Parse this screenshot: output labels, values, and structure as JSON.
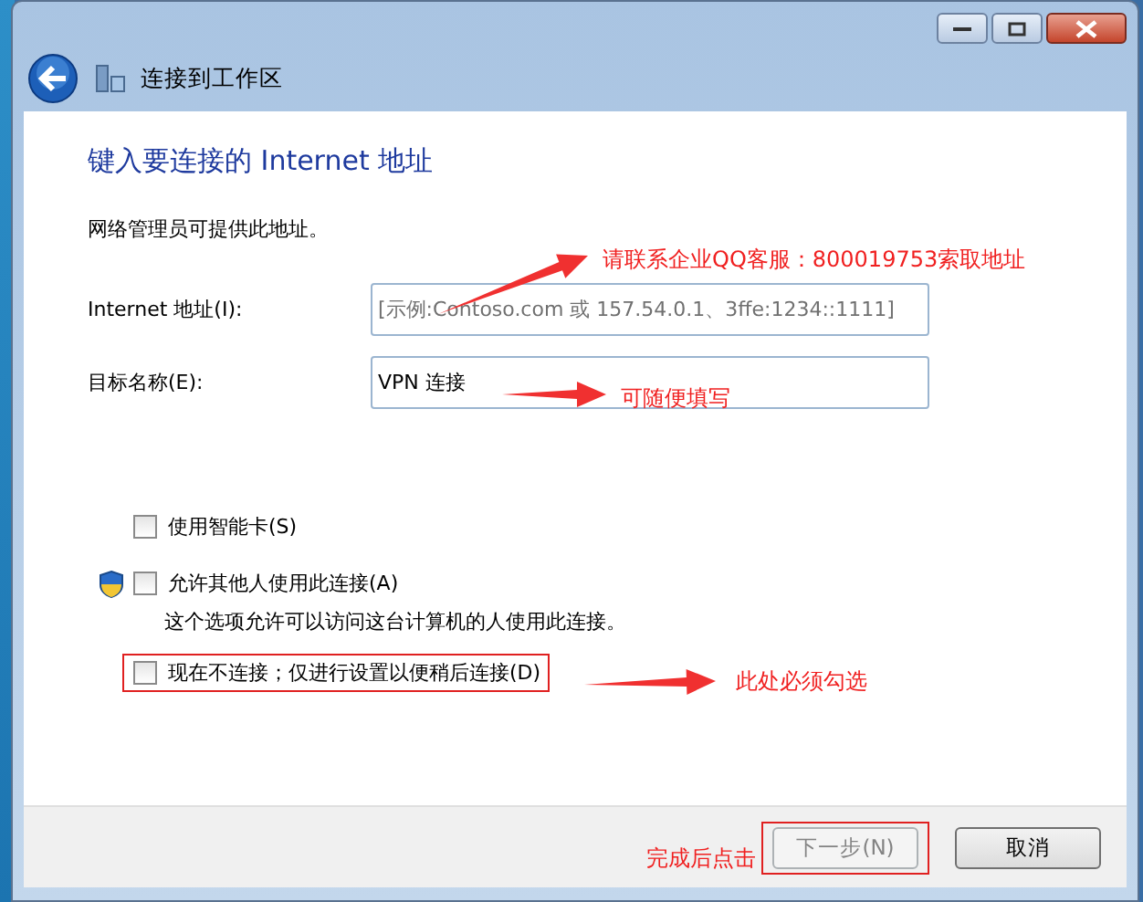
{
  "window": {
    "title": "连接到工作区"
  },
  "heading": "键入要连接的 Internet 地址",
  "note": "网络管理员可提供此地址。",
  "fields": [
    {
      "label": "Internet 地址(I):",
      "placeholder": "[示例:Contoso.com 或 157.54.0.1、3ffe:1234::1111]"
    },
    {
      "label": "目标名称(E):",
      "value": "VPN 连接"
    }
  ],
  "options": [
    {
      "label": "使用智能卡(S)",
      "checked": false,
      "shield": false,
      "highlighted": false
    },
    {
      "label": "允许其他人使用此连接(A)",
      "checked": false,
      "shield": true,
      "highlighted": false,
      "description": "这个选项允许可以访问这台计算机的人使用此连接。"
    },
    {
      "label": "现在不连接；仅进行设置以便稍后连接(D)",
      "checked": false,
      "shield": false,
      "highlighted": true
    }
  ],
  "buttons": [
    {
      "label": "下一步(N)",
      "disabled": true,
      "highlighted": true
    },
    {
      "label": "取消",
      "disabled": false,
      "highlighted": false
    }
  ],
  "annotations": [
    {
      "text": "请联系企业QQ客服：800019753索取地址"
    },
    {
      "text": "可随便填写"
    },
    {
      "text": "此处必须勾选"
    },
    {
      "text": "完成后点击"
    }
  ]
}
